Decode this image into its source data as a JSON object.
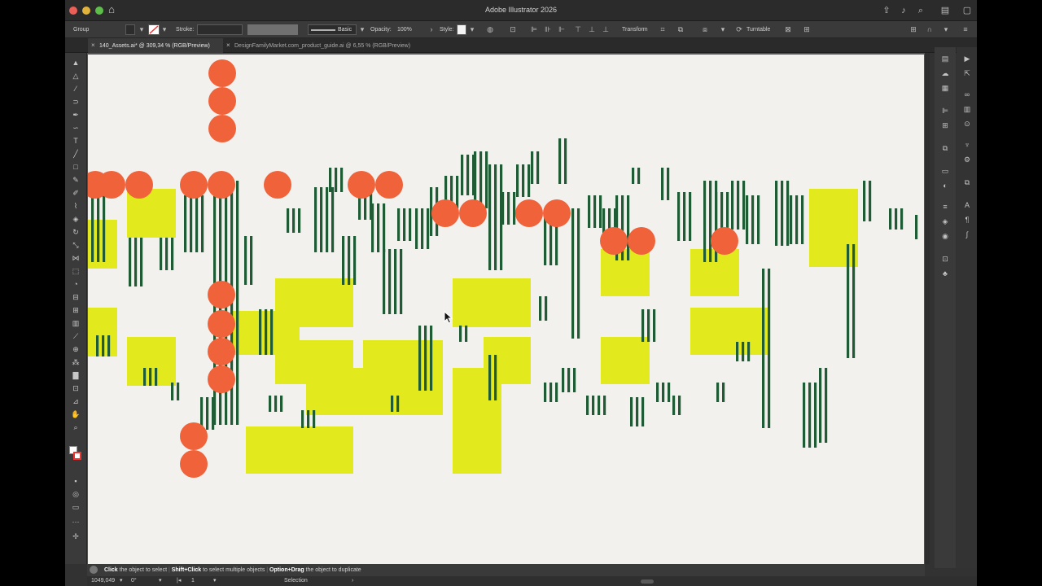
{
  "window": {
    "title": "Adobe Illustrator 2026"
  },
  "control_bar": {
    "selection_type": "Group",
    "stroke_label": "Stroke:",
    "brush_label": "Basic",
    "opacity_label": "Opacity:",
    "opacity_value": "100%",
    "style_label": "Style:",
    "transform_label": "Transform",
    "turntable_label": "Turntable"
  },
  "tabs": [
    {
      "label": "140_Assets.ai* @ 309,34 % (RGB/Preview)",
      "active": true
    },
    {
      "label": "DesignFamilyMarket.com_product_guide.ai @ 6,55 % (RGB/Preview)",
      "active": false
    }
  ],
  "status_hint": {
    "part1_bold": "Click",
    "part1_rest": "the object to select",
    "part2_bold": "Shift+Click",
    "part2_rest": "to select multiple objects",
    "part3_bold": "Option+Drag",
    "part3_rest": "the object to duplicate"
  },
  "bottom_bar": {
    "zoom": "1049,049",
    "rotation": "0°",
    "artboard_number": "1",
    "tool_name": "Selection"
  },
  "colors": {
    "circle": "#f0623a",
    "rect": "#e2e91c",
    "stripe": "#1f5c36",
    "artboard": "#f2f1ee"
  },
  "icons": {
    "toolbar": [
      "selection-tool-icon",
      "direct-selection-tool-icon",
      "magic-wand-icon",
      "lasso-icon",
      "pen-tool-icon",
      "curvature-icon",
      "type-tool-icon",
      "line-tool-icon",
      "rectangle-tool-icon",
      "paintbrush-icon",
      "pencil-icon",
      "shaper-icon",
      "eraser-icon",
      "rotate-icon",
      "scale-icon",
      "width-icon",
      "free-transform-icon",
      "shape-builder-icon",
      "perspective-icon",
      "mesh-icon",
      "gradient-icon",
      "eyedropper-icon",
      "blend-icon",
      "symbol-sprayer-icon",
      "graph-icon",
      "artboard-tool-icon",
      "slice-icon",
      "hand-icon",
      "zoom-icon"
    ]
  }
}
